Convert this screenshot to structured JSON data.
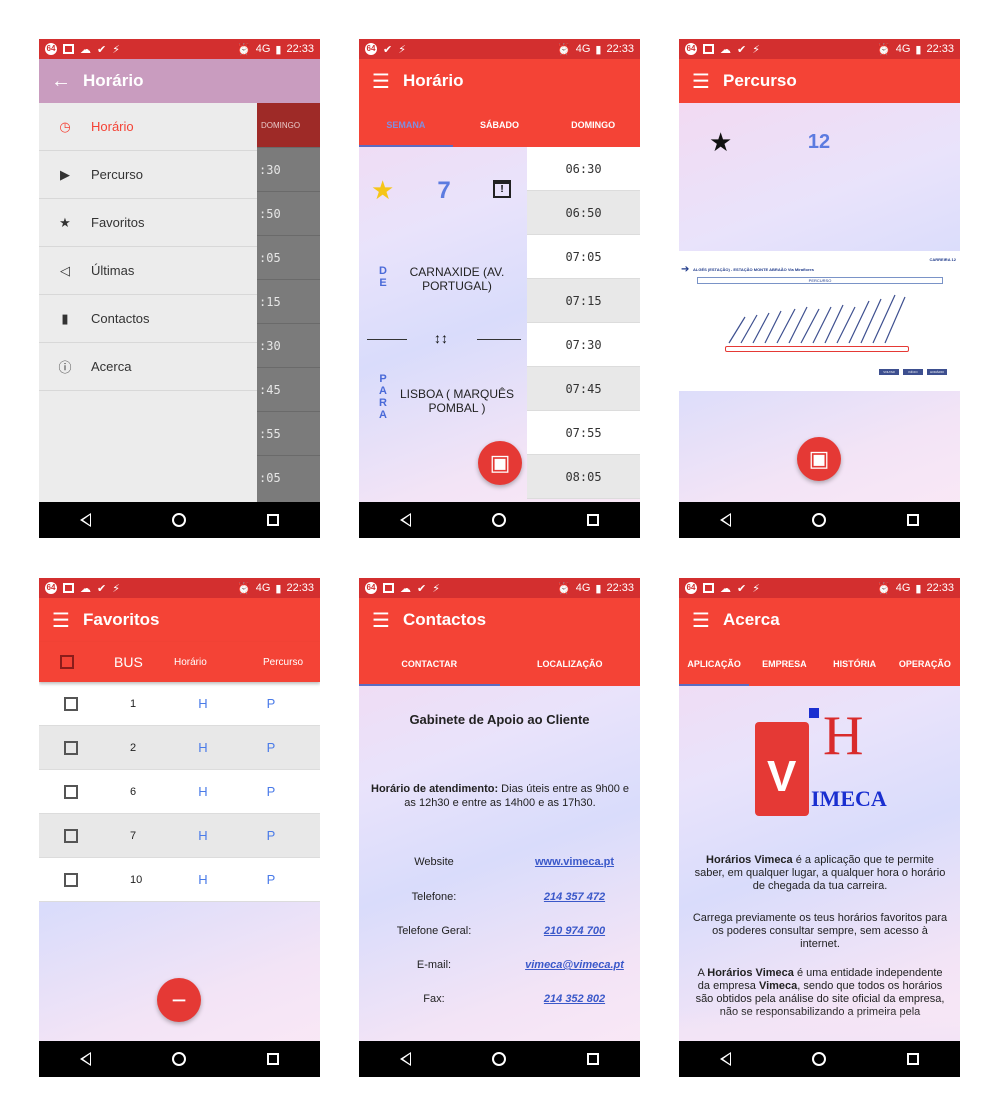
{
  "status": {
    "time": "22:33",
    "network": "4G",
    "left_badge": "64"
  },
  "nav": {
    "back": "back-triangle",
    "home": "home-circle",
    "recent": "recent-square"
  },
  "colors": {
    "primary": "#f44336",
    "primary_dark": "#d32f2f",
    "accent": "#5c7be0",
    "link": "#3a58c9"
  },
  "p1": {
    "title": "Horário",
    "drawer_items": [
      {
        "label": "Horário",
        "icon": "clock-icon"
      },
      {
        "label": "Percurso",
        "icon": "signpost-icon"
      },
      {
        "label": "Favoritos",
        "icon": "star-icon"
      },
      {
        "label": "Últimas",
        "icon": "megaphone-icon"
      },
      {
        "label": "Contactos",
        "icon": "contacts-book-icon"
      },
      {
        "label": "Acerca",
        "icon": "info-icon"
      }
    ],
    "bg_tab": "DOMINGO",
    "bg_times": [
      ":30",
      ":50",
      ":05",
      ":15",
      ":30",
      ":45",
      ":55",
      ":05"
    ]
  },
  "p2": {
    "title": "Horário",
    "tabs": [
      "SEMANA",
      "SÁBADO",
      "DOMINGO"
    ],
    "bus": "7",
    "from_label": [
      "D",
      "E"
    ],
    "from": "CARNAXIDE (AV. PORTUGAL)",
    "to_label": [
      "P",
      "A",
      "R",
      "A"
    ],
    "to": "LISBOA ( MARQUÊS POMBAL )",
    "times": [
      "06:30",
      "06:50",
      "07:05",
      "07:15",
      "07:30",
      "07:45",
      "07:55",
      "08:05"
    ]
  },
  "p3": {
    "title": "Percurso",
    "bus": "12",
    "map_title": "ALGÉS (ESTAÇÃO) - ESTAÇÃO MONTE ABRAÃO Via Miraflores",
    "map_carreira": "CARREIRA 12",
    "map_bar": "PERCURSO",
    "map_buttons": [
      "VOLTAR",
      "INÍCIO",
      "HORÁRIO"
    ]
  },
  "p4": {
    "title": "Favoritos",
    "headers": {
      "bus": "BUS",
      "horario": "Horário",
      "percurso": "Percurso"
    },
    "rows": [
      {
        "num": "1",
        "h": "H",
        "p": "P"
      },
      {
        "num": "2",
        "h": "H",
        "p": "P"
      },
      {
        "num": "6",
        "h": "H",
        "p": "P"
      },
      {
        "num": "7",
        "h": "H",
        "p": "P"
      },
      {
        "num": "10",
        "h": "H",
        "p": "P"
      }
    ]
  },
  "p5": {
    "title": "Contactos",
    "tabs": [
      "CONTACTAR",
      "LOCALIZAÇÃO"
    ],
    "heading": "Gabinete de Apoio ao Cliente",
    "hours_label": "Horário de atendimento:",
    "hours_text": " Dias úteis entre as 9h00 e as 12h30 e entre as 14h00 e as 17h30.",
    "contacts": [
      {
        "k": "Website",
        "v": "www.vimeca.pt"
      },
      {
        "k": "Telefone:",
        "v": "214 357 472"
      },
      {
        "k": "Telefone Geral:",
        "v": "210 974 700"
      },
      {
        "k": "E-mail:",
        "v": "vimeca@vimeca.pt"
      },
      {
        "k": "Fax:",
        "v": "214 352 802"
      }
    ]
  },
  "p6": {
    "title": "Acerca",
    "tabs": [
      "APLICAÇÃO",
      "EMPRESA",
      "HISTÓRIA",
      "OPERAÇÃO"
    ],
    "logo_h": "H",
    "logo_text": "IMECA",
    "para1_bold": "Horários Vimeca",
    "para1": " é a aplicação que te permite saber, em qualquer lugar, a qualquer hora o horário de chegada da tua carreira.",
    "para2": "Carrega previamente os teus horários favoritos para os poderes consultar sempre, sem acesso à internet.",
    "para3_a": "A ",
    "para3_bold": "Horários Vimeca",
    "para3_b": " é uma entidade independente da empresa ",
    "para3_bold2": "Vimeca",
    "para3_c": ", sendo que todos os horários são obtidos pela análise do site oficial da empresa, não se responsabilizando a primeira pela"
  }
}
